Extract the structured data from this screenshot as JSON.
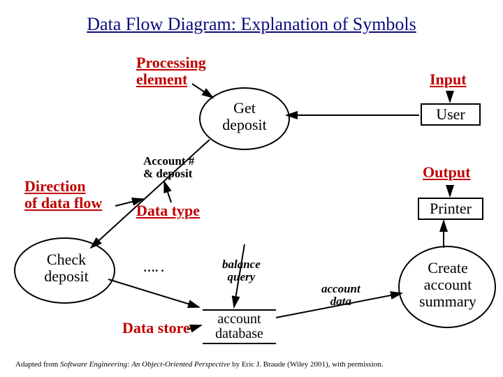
{
  "title": "Data Flow Diagram: Explanation of Symbols",
  "labels": {
    "processing_element": "Processing\nelement",
    "direction": "Direction\nof data flow",
    "data_type": "Data type",
    "data_store_label": "Data store",
    "account_deposit": "Account #\n& deposit",
    "dots": "…. .",
    "balance_query": "balance\nquery",
    "account_data": "account\ndata",
    "input": "Input",
    "output": "Output"
  },
  "nodes": {
    "get_deposit": "Get\ndeposit",
    "check_deposit": "Check\ndeposit",
    "user": "User",
    "printer": "Printer",
    "create_summary": "Create\naccount\nsummary",
    "account_db": "account\ndatabase"
  },
  "footer": {
    "prefix": "Adapted from ",
    "book": "Software Engineering: An Object-Oriented Perspective",
    "suffix": " by Eric J. Braude (Wiley 2001), with permission."
  }
}
